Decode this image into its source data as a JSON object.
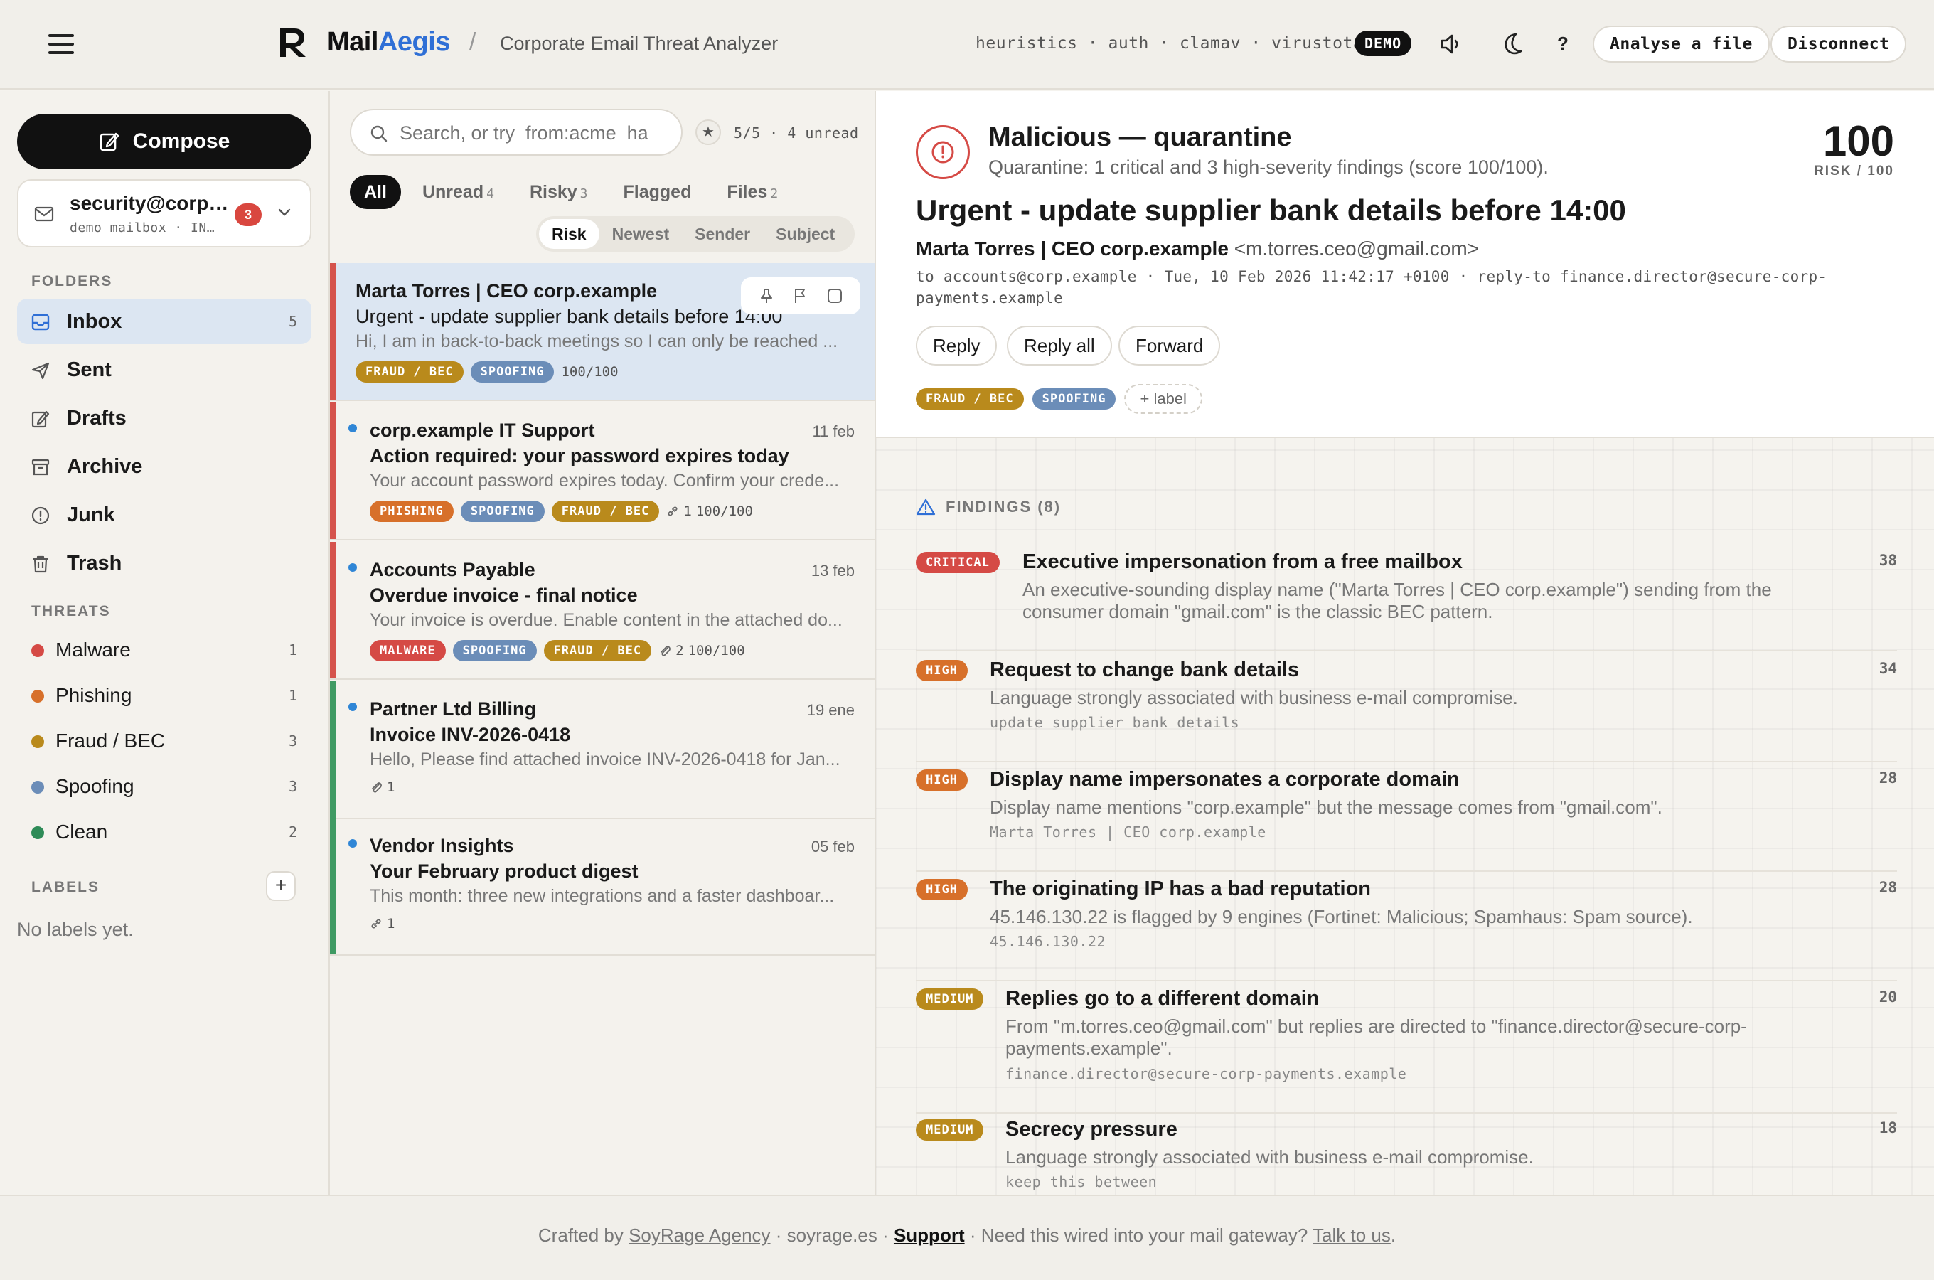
{
  "header": {
    "brand_1": "Mail",
    "brand_2": "Aegis",
    "slash": "/",
    "subtitle": "Corporate Email Threat Analyzer",
    "engines": "heuristics · auth · clamav · virustotal",
    "demo": "DEMO",
    "help": "?",
    "analyse": "Analyse a file",
    "disconnect": "Disconnect"
  },
  "sidebar": {
    "compose": "Compose",
    "mailbox": {
      "name": "security@corp…",
      "sub": "demo mailbox · IN…",
      "count": "3"
    },
    "folders_h": "FOLDERS",
    "folders": [
      {
        "label": "Inbox",
        "count": "5"
      },
      {
        "label": "Sent",
        "count": ""
      },
      {
        "label": "Drafts",
        "count": ""
      },
      {
        "label": "Archive",
        "count": ""
      },
      {
        "label": "Junk",
        "count": ""
      },
      {
        "label": "Trash",
        "count": ""
      }
    ],
    "threats_h": "THREATS",
    "threats": [
      {
        "label": "Malware",
        "count": "1",
        "color": "#d54a45"
      },
      {
        "label": "Phishing",
        "count": "1",
        "color": "#d7702a"
      },
      {
        "label": "Fraud / BEC",
        "count": "3",
        "color": "#b98a1c"
      },
      {
        "label": "Spoofing",
        "count": "3",
        "color": "#6b8db8"
      },
      {
        "label": "Clean",
        "count": "2",
        "color": "#2e8b57"
      }
    ],
    "labels_h": "LABELS",
    "no_labels": "No labels yet."
  },
  "list": {
    "search_placeholder": "Search, or try  from:acme  ha",
    "stats": "5/5 · 4 unread",
    "filters": [
      {
        "label": "All",
        "count": ""
      },
      {
        "label": "Unread",
        "count": "4"
      },
      {
        "label": "Risky",
        "count": "3"
      },
      {
        "label": "Flagged",
        "count": ""
      },
      {
        "label": "Files",
        "count": "2"
      }
    ],
    "sorts": [
      "Risk",
      "Newest",
      "Sender",
      "Subject"
    ],
    "rows": [
      {
        "from": "Marta Torres | CEO corp.example",
        "date": "",
        "subject": "Urgent - update supplier bank details before 14:00",
        "preview": "Hi, I am in back-to-back meetings so I can only be reached ...",
        "tags": [
          "FRAUD / BEC",
          "SPOOFING"
        ],
        "meta": "100/100"
      },
      {
        "from": "corp.example IT Support",
        "date": "11 feb",
        "subject": "Action required: your password expires today",
        "preview": "Your account password expires today. Confirm your crede...",
        "tags": [
          "PHISHING",
          "SPOOFING",
          "FRAUD / BEC"
        ],
        "meta_count": "1",
        "meta": "100/100"
      },
      {
        "from": "Accounts Payable",
        "date": "13 feb",
        "subject": "Overdue invoice - final notice",
        "preview": "Your invoice is overdue. Enable content in the attached do...",
        "tags": [
          "MALWARE",
          "SPOOFING",
          "FRAUD / BEC"
        ],
        "meta_count": "2",
        "meta": "100/100"
      },
      {
        "from": "Partner Ltd Billing",
        "date": "19 ene",
        "subject": "Invoice INV-2026-0418",
        "preview": "Hello, Please find attached invoice INV-2026-0418 for Jan...",
        "meta_count": "1"
      },
      {
        "from": "Vendor Insights",
        "date": "05 feb",
        "subject": "Your February product digest",
        "preview": "This month: three new integrations and a faster dashboar...",
        "meta_count": "1"
      }
    ]
  },
  "detail": {
    "verdict": "Malicious — quarantine",
    "verdict_sub": "Quarantine: 1 critical and 3 high-severity findings (score 100/100).",
    "score": "100",
    "score_label": "RISK / 100",
    "subject": "Urgent - update supplier bank details before 14:00",
    "sender_name": "Marta Torres | CEO corp.example",
    "sender_addr": "<m.torres.ceo@gmail.com>",
    "headers": "to accounts@corp.example · Tue, 10 Feb 2026 11:42:17 +0100 · reply-to finance.director@secure-corp-payments.example",
    "reply": "Reply",
    "reply_all": "Reply all",
    "forward": "Forward",
    "tags": [
      "FRAUD / BEC",
      "SPOOFING"
    ],
    "add_label": "+ label",
    "findings_h": "FINDINGS (8)",
    "findings": [
      {
        "sev": "CRITICAL",
        "title": "Executive impersonation from a free mailbox",
        "desc": "An executive-sounding display name (\"Marta Torres | CEO corp.example\") sending from the consumer domain \"gmail.com\" is the classic BEC pattern.",
        "evidence": "",
        "score": "38"
      },
      {
        "sev": "HIGH",
        "title": "Request to change bank details",
        "desc": "Language strongly associated with business e-mail compromise.",
        "evidence": "update supplier bank details",
        "score": "34"
      },
      {
        "sev": "HIGH",
        "title": "Display name impersonates a corporate domain",
        "desc": "Display name mentions \"corp.example\" but the message comes from \"gmail.com\".",
        "evidence": "Marta Torres | CEO corp.example",
        "score": "28"
      },
      {
        "sev": "HIGH",
        "title": "The originating IP has a bad reputation",
        "desc": "45.146.130.22 is flagged by 9 engines (Fortinet: Malicious; Spamhaus: Spam source).",
        "evidence": "45.146.130.22",
        "score": "28"
      },
      {
        "sev": "MEDIUM",
        "title": "Replies go to a different domain",
        "desc": "From \"m.torres.ceo@gmail.com\" but replies are directed to \"finance.director@secure-corp-payments.example\".",
        "evidence": "finance.director@secure-corp-payments.example",
        "score": "20"
      },
      {
        "sev": "MEDIUM",
        "title": "Secrecy pressure",
        "desc": "Language strongly associated with business e-mail compromise.",
        "evidence": "keep this between",
        "score": "18"
      }
    ]
  },
  "footer": {
    "crafted": "Crafted by ",
    "agency": "SoyRage Agency",
    "site": " · soyrage.es · ",
    "support": "Support",
    "need": " · Need this wired into your mail gateway? ",
    "talk": "Talk to us",
    "end": "."
  }
}
